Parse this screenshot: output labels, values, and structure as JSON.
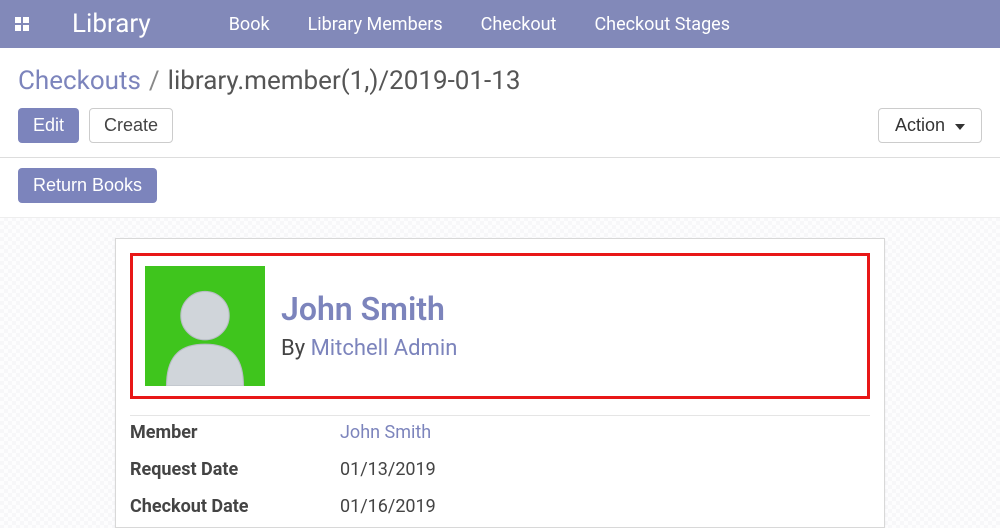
{
  "navbar": {
    "brand": "Library",
    "items": [
      "Book",
      "Library Members",
      "Checkout",
      "Checkout Stages"
    ]
  },
  "breadcrumb": {
    "link": "Checkouts",
    "current": "library.member(1,)/2019-01-13"
  },
  "toolbar": {
    "edit_label": "Edit",
    "create_label": "Create",
    "action_label": "Action"
  },
  "secondary": {
    "return_books_label": "Return Books"
  },
  "record": {
    "title_name": "John Smith",
    "by_label": "By",
    "by_user": "Mitchell Admin",
    "fields": [
      {
        "label": "Member",
        "value": "John Smith",
        "is_link": true
      },
      {
        "label": "Request Date",
        "value": "01/13/2019",
        "is_link": false
      },
      {
        "label": "Checkout Date",
        "value": "01/16/2019",
        "is_link": false
      }
    ]
  }
}
